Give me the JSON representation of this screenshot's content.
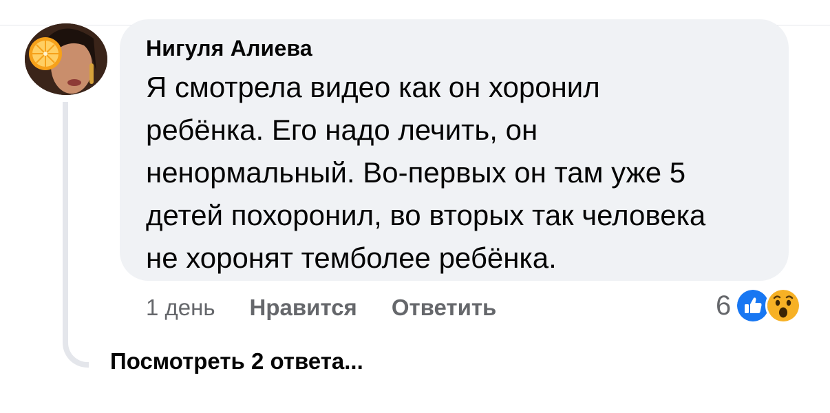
{
  "comment": {
    "author": "Нигуля Алиева",
    "text_lines": [
      "Я смотрела видео как он хоронил",
      "ребёнка. Его надо лечить, он",
      "ненормальный. Во-первых он там уже 5",
      "детей похоронил, во вторых так человека",
      "не хоронят темболее ребёнка."
    ]
  },
  "actions": {
    "time": "1 день",
    "like_label": "Нравится",
    "reply_label": "Ответить"
  },
  "reactions": {
    "count": "6",
    "icons": [
      "like-icon",
      "wow-icon"
    ],
    "colors": {
      "like": "#1877f2",
      "wow": "#f7b125"
    }
  },
  "replies": {
    "label": "Посмотреть 2 ответа..."
  },
  "colors": {
    "bubble": "#f0f2f5",
    "secondary_text": "#65676b",
    "primary_text": "#050505",
    "thread_line": "#e4e6eb"
  }
}
